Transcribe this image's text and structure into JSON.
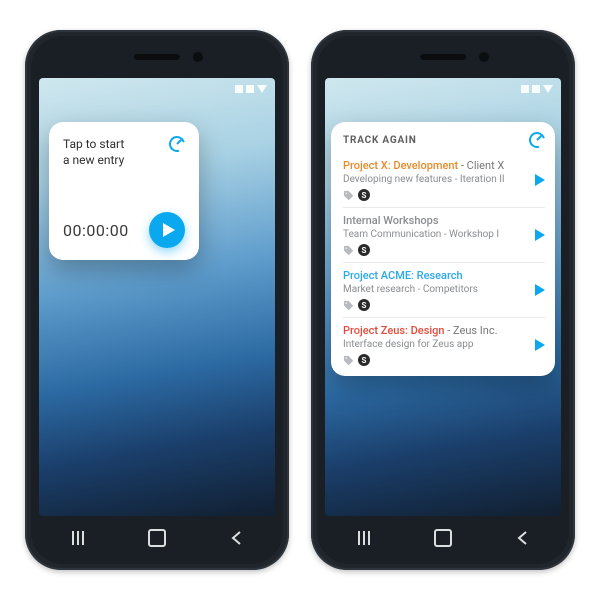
{
  "brand_color": "#0aa8ef",
  "left_widget": {
    "prompt_line1": "Tap to start",
    "prompt_line2": "a new entry",
    "timer": "00:00:00"
  },
  "right_widget": {
    "title": "TRACK AGAIN",
    "entries": [
      {
        "project": "Project X: Development",
        "client": " - Client X",
        "project_color": "#e88a2a",
        "desc": "Developing new features - Iteration II"
      },
      {
        "project": "Internal Workshops",
        "client": "",
        "project_color": "#8a8d90",
        "desc": "Team Communication - Workshop I"
      },
      {
        "project": "Project ACME: Research",
        "client": "",
        "project_color": "#2aa8ef",
        "desc": "Market research - Competitors"
      },
      {
        "project": "Project Zeus: Design",
        "client": " - Zeus Inc.",
        "project_color": "#e24b3b",
        "desc": "Interface design for Zeus app"
      }
    ]
  },
  "billable_glyph": "S"
}
